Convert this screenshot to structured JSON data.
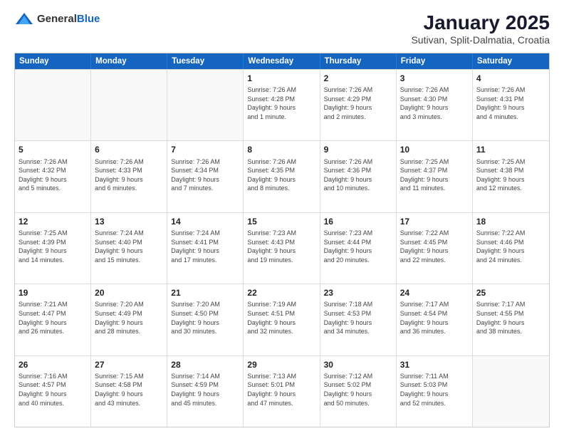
{
  "logo": {
    "general": "General",
    "blue": "Blue"
  },
  "header": {
    "title": "January 2025",
    "subtitle": "Sutivan, Split-Dalmatia, Croatia"
  },
  "weekdays": [
    "Sunday",
    "Monday",
    "Tuesday",
    "Wednesday",
    "Thursday",
    "Friday",
    "Saturday"
  ],
  "weeks": [
    [
      {
        "day": "",
        "text": "",
        "empty": true
      },
      {
        "day": "",
        "text": "",
        "empty": true
      },
      {
        "day": "",
        "text": "",
        "empty": true
      },
      {
        "day": "1",
        "text": "Sunrise: 7:26 AM\nSunset: 4:28 PM\nDaylight: 9 hours\nand 1 minute.",
        "empty": false
      },
      {
        "day": "2",
        "text": "Sunrise: 7:26 AM\nSunset: 4:29 PM\nDaylight: 9 hours\nand 2 minutes.",
        "empty": false
      },
      {
        "day": "3",
        "text": "Sunrise: 7:26 AM\nSunset: 4:30 PM\nDaylight: 9 hours\nand 3 minutes.",
        "empty": false
      },
      {
        "day": "4",
        "text": "Sunrise: 7:26 AM\nSunset: 4:31 PM\nDaylight: 9 hours\nand 4 minutes.",
        "empty": false
      }
    ],
    [
      {
        "day": "5",
        "text": "Sunrise: 7:26 AM\nSunset: 4:32 PM\nDaylight: 9 hours\nand 5 minutes.",
        "empty": false
      },
      {
        "day": "6",
        "text": "Sunrise: 7:26 AM\nSunset: 4:33 PM\nDaylight: 9 hours\nand 6 minutes.",
        "empty": false
      },
      {
        "day": "7",
        "text": "Sunrise: 7:26 AM\nSunset: 4:34 PM\nDaylight: 9 hours\nand 7 minutes.",
        "empty": false
      },
      {
        "day": "8",
        "text": "Sunrise: 7:26 AM\nSunset: 4:35 PM\nDaylight: 9 hours\nand 8 minutes.",
        "empty": false
      },
      {
        "day": "9",
        "text": "Sunrise: 7:26 AM\nSunset: 4:36 PM\nDaylight: 9 hours\nand 10 minutes.",
        "empty": false
      },
      {
        "day": "10",
        "text": "Sunrise: 7:25 AM\nSunset: 4:37 PM\nDaylight: 9 hours\nand 11 minutes.",
        "empty": false
      },
      {
        "day": "11",
        "text": "Sunrise: 7:25 AM\nSunset: 4:38 PM\nDaylight: 9 hours\nand 12 minutes.",
        "empty": false
      }
    ],
    [
      {
        "day": "12",
        "text": "Sunrise: 7:25 AM\nSunset: 4:39 PM\nDaylight: 9 hours\nand 14 minutes.",
        "empty": false
      },
      {
        "day": "13",
        "text": "Sunrise: 7:24 AM\nSunset: 4:40 PM\nDaylight: 9 hours\nand 15 minutes.",
        "empty": false
      },
      {
        "day": "14",
        "text": "Sunrise: 7:24 AM\nSunset: 4:41 PM\nDaylight: 9 hours\nand 17 minutes.",
        "empty": false
      },
      {
        "day": "15",
        "text": "Sunrise: 7:23 AM\nSunset: 4:43 PM\nDaylight: 9 hours\nand 19 minutes.",
        "empty": false
      },
      {
        "day": "16",
        "text": "Sunrise: 7:23 AM\nSunset: 4:44 PM\nDaylight: 9 hours\nand 20 minutes.",
        "empty": false
      },
      {
        "day": "17",
        "text": "Sunrise: 7:22 AM\nSunset: 4:45 PM\nDaylight: 9 hours\nand 22 minutes.",
        "empty": false
      },
      {
        "day": "18",
        "text": "Sunrise: 7:22 AM\nSunset: 4:46 PM\nDaylight: 9 hours\nand 24 minutes.",
        "empty": false
      }
    ],
    [
      {
        "day": "19",
        "text": "Sunrise: 7:21 AM\nSunset: 4:47 PM\nDaylight: 9 hours\nand 26 minutes.",
        "empty": false
      },
      {
        "day": "20",
        "text": "Sunrise: 7:20 AM\nSunset: 4:49 PM\nDaylight: 9 hours\nand 28 minutes.",
        "empty": false
      },
      {
        "day": "21",
        "text": "Sunrise: 7:20 AM\nSunset: 4:50 PM\nDaylight: 9 hours\nand 30 minutes.",
        "empty": false
      },
      {
        "day": "22",
        "text": "Sunrise: 7:19 AM\nSunset: 4:51 PM\nDaylight: 9 hours\nand 32 minutes.",
        "empty": false
      },
      {
        "day": "23",
        "text": "Sunrise: 7:18 AM\nSunset: 4:53 PM\nDaylight: 9 hours\nand 34 minutes.",
        "empty": false
      },
      {
        "day": "24",
        "text": "Sunrise: 7:17 AM\nSunset: 4:54 PM\nDaylight: 9 hours\nand 36 minutes.",
        "empty": false
      },
      {
        "day": "25",
        "text": "Sunrise: 7:17 AM\nSunset: 4:55 PM\nDaylight: 9 hours\nand 38 minutes.",
        "empty": false
      }
    ],
    [
      {
        "day": "26",
        "text": "Sunrise: 7:16 AM\nSunset: 4:57 PM\nDaylight: 9 hours\nand 40 minutes.",
        "empty": false
      },
      {
        "day": "27",
        "text": "Sunrise: 7:15 AM\nSunset: 4:58 PM\nDaylight: 9 hours\nand 43 minutes.",
        "empty": false
      },
      {
        "day": "28",
        "text": "Sunrise: 7:14 AM\nSunset: 4:59 PM\nDaylight: 9 hours\nand 45 minutes.",
        "empty": false
      },
      {
        "day": "29",
        "text": "Sunrise: 7:13 AM\nSunset: 5:01 PM\nDaylight: 9 hours\nand 47 minutes.",
        "empty": false
      },
      {
        "day": "30",
        "text": "Sunrise: 7:12 AM\nSunset: 5:02 PM\nDaylight: 9 hours\nand 50 minutes.",
        "empty": false
      },
      {
        "day": "31",
        "text": "Sunrise: 7:11 AM\nSunset: 5:03 PM\nDaylight: 9 hours\nand 52 minutes.",
        "empty": false
      },
      {
        "day": "",
        "text": "",
        "empty": true
      }
    ]
  ]
}
